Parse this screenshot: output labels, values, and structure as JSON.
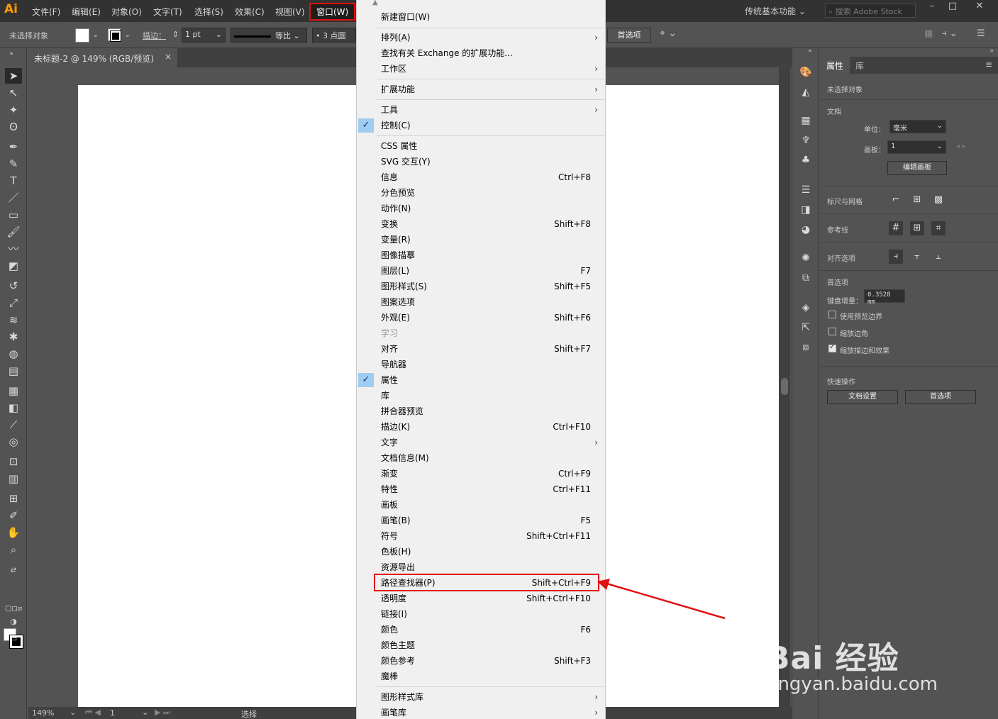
{
  "app": {
    "logo": "Ai"
  },
  "menubar": {
    "items": [
      "文件(F)",
      "编辑(E)",
      "对象(O)",
      "文字(T)",
      "选择(S)",
      "效果(C)",
      "视图(V)",
      "窗口(W)"
    ],
    "workspace": "传统基本功能",
    "search_placeholder": "搜索 Adobe Stock"
  },
  "control_bar": {
    "no_selection": "未选择对象",
    "stroke_label": "描边：",
    "stroke_weight": "1 pt",
    "stroke_profile": "等比",
    "brush": "3 点圆",
    "preferences": "首选项"
  },
  "document": {
    "tab_title": "未标题-2 @ 149% (RGB/预览)",
    "zoom": "149%",
    "artboard_number": "1",
    "status": "选择"
  },
  "window_menu": {
    "highlight_color": "#e01010",
    "items": [
      {
        "label": "新建窗口(W)",
        "shortcut": "",
        "submenu": false,
        "checked": false,
        "disabled": false
      },
      {
        "label": "排列(A)",
        "shortcut": "",
        "submenu": true,
        "checked": false,
        "disabled": false
      },
      {
        "label": "查找有关 Exchange 的扩展功能...",
        "shortcut": "",
        "submenu": false,
        "checked": false,
        "disabled": false
      },
      {
        "label": "工作区",
        "shortcut": "",
        "submenu": true,
        "checked": false,
        "disabled": false
      },
      {
        "label": "扩展功能",
        "shortcut": "",
        "submenu": true,
        "checked": false,
        "disabled": false
      },
      {
        "label": "工具",
        "shortcut": "",
        "submenu": true,
        "checked": false,
        "disabled": false
      },
      {
        "label": "控制(C)",
        "shortcut": "",
        "submenu": false,
        "checked": true,
        "disabled": false
      },
      {
        "label": "CSS 属性",
        "shortcut": "",
        "submenu": false,
        "checked": false,
        "disabled": false
      },
      {
        "label": "SVG 交互(Y)",
        "shortcut": "",
        "submenu": false,
        "checked": false,
        "disabled": false
      },
      {
        "label": "信息",
        "shortcut": "Ctrl+F8",
        "submenu": false,
        "checked": false,
        "disabled": false
      },
      {
        "label": "分色预览",
        "shortcut": "",
        "submenu": false,
        "checked": false,
        "disabled": false
      },
      {
        "label": "动作(N)",
        "shortcut": "",
        "submenu": false,
        "checked": false,
        "disabled": false
      },
      {
        "label": "变换",
        "shortcut": "Shift+F8",
        "submenu": false,
        "checked": false,
        "disabled": false
      },
      {
        "label": "变量(R)",
        "shortcut": "",
        "submenu": false,
        "checked": false,
        "disabled": false
      },
      {
        "label": "图像描摹",
        "shortcut": "",
        "submenu": false,
        "checked": false,
        "disabled": false
      },
      {
        "label": "图层(L)",
        "shortcut": "F7",
        "submenu": false,
        "checked": false,
        "disabled": false
      },
      {
        "label": "图形样式(S)",
        "shortcut": "Shift+F5",
        "submenu": false,
        "checked": false,
        "disabled": false
      },
      {
        "label": "图案选项",
        "shortcut": "",
        "submenu": false,
        "checked": false,
        "disabled": false
      },
      {
        "label": "外观(E)",
        "shortcut": "Shift+F6",
        "submenu": false,
        "checked": false,
        "disabled": false
      },
      {
        "label": "学习",
        "shortcut": "",
        "submenu": false,
        "checked": false,
        "disabled": true
      },
      {
        "label": "对齐",
        "shortcut": "Shift+F7",
        "submenu": false,
        "checked": false,
        "disabled": false
      },
      {
        "label": "导航器",
        "shortcut": "",
        "submenu": false,
        "checked": false,
        "disabled": false
      },
      {
        "label": "属性",
        "shortcut": "",
        "submenu": false,
        "checked": true,
        "disabled": false
      },
      {
        "label": "库",
        "shortcut": "",
        "submenu": false,
        "checked": false,
        "disabled": false
      },
      {
        "label": "拼合器预览",
        "shortcut": "",
        "submenu": false,
        "checked": false,
        "disabled": false
      },
      {
        "label": "描边(K)",
        "shortcut": "Ctrl+F10",
        "submenu": false,
        "checked": false,
        "disabled": false
      },
      {
        "label": "文字",
        "shortcut": "",
        "submenu": true,
        "checked": false,
        "disabled": false
      },
      {
        "label": "文档信息(M)",
        "shortcut": "",
        "submenu": false,
        "checked": false,
        "disabled": false
      },
      {
        "label": "渐变",
        "shortcut": "Ctrl+F9",
        "submenu": false,
        "checked": false,
        "disabled": false
      },
      {
        "label": "特性",
        "shortcut": "Ctrl+F11",
        "submenu": false,
        "checked": false,
        "disabled": false
      },
      {
        "label": "画板",
        "shortcut": "",
        "submenu": false,
        "checked": false,
        "disabled": false
      },
      {
        "label": "画笔(B)",
        "shortcut": "F5",
        "submenu": false,
        "checked": false,
        "disabled": false
      },
      {
        "label": "符号",
        "shortcut": "Shift+Ctrl+F11",
        "submenu": false,
        "checked": false,
        "disabled": false
      },
      {
        "label": "色板(H)",
        "shortcut": "",
        "submenu": false,
        "checked": false,
        "disabled": false
      },
      {
        "label": "资源导出",
        "shortcut": "",
        "submenu": false,
        "checked": false,
        "disabled": false
      },
      {
        "label": "路径查找器(P)",
        "shortcut": "Shift+Ctrl+F9",
        "submenu": false,
        "checked": false,
        "disabled": false
      },
      {
        "label": "透明度",
        "shortcut": "Shift+Ctrl+F10",
        "submenu": false,
        "checked": false,
        "disabled": false
      },
      {
        "label": "链接(I)",
        "shortcut": "",
        "submenu": false,
        "checked": false,
        "disabled": false
      },
      {
        "label": "颜色",
        "shortcut": "F6",
        "submenu": false,
        "checked": false,
        "disabled": false
      },
      {
        "label": "颜色主题",
        "shortcut": "",
        "submenu": false,
        "checked": false,
        "disabled": false
      },
      {
        "label": "颜色参考",
        "shortcut": "Shift+F3",
        "submenu": false,
        "checked": false,
        "disabled": false
      },
      {
        "label": "魔棒",
        "shortcut": "",
        "submenu": false,
        "checked": false,
        "disabled": false
      },
      {
        "label": "图形样式库",
        "shortcut": "",
        "submenu": true,
        "checked": false,
        "disabled": false
      },
      {
        "label": "画笔库",
        "shortcut": "",
        "submenu": true,
        "checked": false,
        "disabled": false
      }
    ]
  },
  "properties_panel": {
    "tabs": [
      "属性",
      "库"
    ],
    "no_selection": "未选择对象",
    "document_section": "文档",
    "units_label": "单位：",
    "units_value": "毫米",
    "artboard_label": "画板：",
    "artboard_value": "1",
    "edit_artboards": "编辑画板",
    "rulers_grids": "标尺与网格",
    "guides": "参考线",
    "snap_options": "对齐选项",
    "preferences_section": "首选项",
    "keyboard_increment_label": "键盘增量：",
    "keyboard_increment_value": "0.3528 mm",
    "use_preview_bounds": "使用预览边界",
    "scale_corners": "缩放边角",
    "scale_strokes_effects": "缩放描边和效果",
    "quick_actions": "快速操作",
    "document_setup": "文档设置",
    "preferences_button": "首选项"
  },
  "watermark": {
    "text": "Bai 经验",
    "url": "jingyan.baidu.com"
  }
}
